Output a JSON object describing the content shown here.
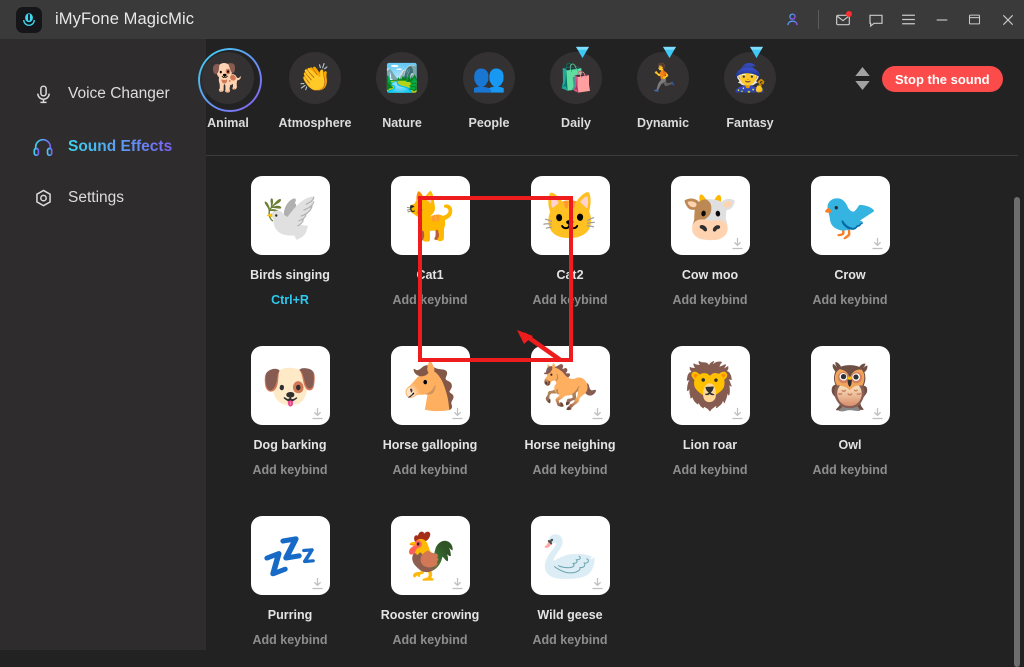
{
  "titlebar": {
    "app_name": "iMyFone MagicMic",
    "logo_icon": "magicmic-logo-icon",
    "controls": [
      {
        "name": "account-icon",
        "glyph": "person"
      },
      {
        "name": "mail-icon",
        "glyph": "envelope",
        "badge": true
      },
      {
        "name": "feedback-icon",
        "glyph": "chat-bubble"
      },
      {
        "name": "menu-icon",
        "glyph": "hamburger"
      },
      {
        "name": "minimize-icon",
        "glyph": "minimize"
      },
      {
        "name": "maximize-icon",
        "glyph": "maximize"
      },
      {
        "name": "close-icon",
        "glyph": "close"
      }
    ]
  },
  "sidebar": {
    "items": [
      {
        "label": "Voice Changer",
        "icon": "microphone-icon",
        "active": false
      },
      {
        "label": "Sound Effects",
        "icon": "headphones-icon",
        "active": true
      },
      {
        "label": "Settings",
        "icon": "gear-icon",
        "active": false
      }
    ]
  },
  "tabs": [
    {
      "label": "Animal",
      "emoji": "🐕",
      "selected": true,
      "vip": false
    },
    {
      "label": "Atmosphere",
      "emoji": "👏",
      "selected": false,
      "vip": false
    },
    {
      "label": "Nature",
      "emoji": "🏞️",
      "selected": false,
      "vip": false
    },
    {
      "label": "People",
      "emoji": "👥",
      "selected": false,
      "vip": false
    },
    {
      "label": "Daily",
      "emoji": "🛍️",
      "selected": false,
      "vip": true
    },
    {
      "label": "Dynamic",
      "emoji": "🏃",
      "selected": false,
      "vip": true
    },
    {
      "label": "Fantasy",
      "emoji": "🧙",
      "selected": false,
      "vip": true
    }
  ],
  "toolbar": {
    "scroll_up_label": "scroll-up",
    "scroll_down_label": "scroll-down",
    "stop_label": "Stop the sound",
    "stop_color": "#fb4b4b"
  },
  "keybind_placeholder": "Add keybind",
  "accent_keybind_color": "#2fc8f0",
  "highlight_color": "#ee1c1c",
  "sounds": [
    {
      "name": "Birds singing",
      "emoji": "🕊️",
      "keybind": "Ctrl+R",
      "bound": true,
      "download": false,
      "highlighted": true
    },
    {
      "name": "Cat1",
      "emoji": "🐈",
      "keybind": "Add keybind",
      "bound": false,
      "download": false,
      "highlighted": false
    },
    {
      "name": "Cat2",
      "emoji": "🐱",
      "keybind": "Add keybind",
      "bound": false,
      "download": false,
      "highlighted": false
    },
    {
      "name": "Cow moo",
      "emoji": "🐮",
      "keybind": "Add keybind",
      "bound": false,
      "download": true,
      "highlighted": false
    },
    {
      "name": "Crow",
      "emoji": "🐦",
      "keybind": "Add keybind",
      "bound": false,
      "download": true,
      "highlighted": false
    },
    {
      "name": "Dog barking",
      "emoji": "🐶",
      "keybind": "Add keybind",
      "bound": false,
      "download": true,
      "highlighted": false
    },
    {
      "name": "Horse galloping",
      "emoji": "🐴",
      "keybind": "Add keybind",
      "bound": false,
      "download": true,
      "highlighted": false
    },
    {
      "name": "Horse neighing",
      "emoji": "🐎",
      "keybind": "Add keybind",
      "bound": false,
      "download": true,
      "highlighted": false
    },
    {
      "name": "Lion roar",
      "emoji": "🦁",
      "keybind": "Add keybind",
      "bound": false,
      "download": true,
      "highlighted": false
    },
    {
      "name": "Owl",
      "emoji": "🦉",
      "keybind": "Add keybind",
      "bound": false,
      "download": true,
      "highlighted": false
    },
    {
      "name": "Purring",
      "emoji": "💤",
      "keybind": "Add keybind",
      "bound": false,
      "download": true,
      "highlighted": false
    },
    {
      "name": "Rooster crowing",
      "emoji": "🐓",
      "keybind": "Add keybind",
      "bound": false,
      "download": true,
      "highlighted": false
    },
    {
      "name": "Wild geese",
      "emoji": "🦢",
      "keybind": "Add keybind",
      "bound": false,
      "download": true,
      "highlighted": false
    }
  ]
}
